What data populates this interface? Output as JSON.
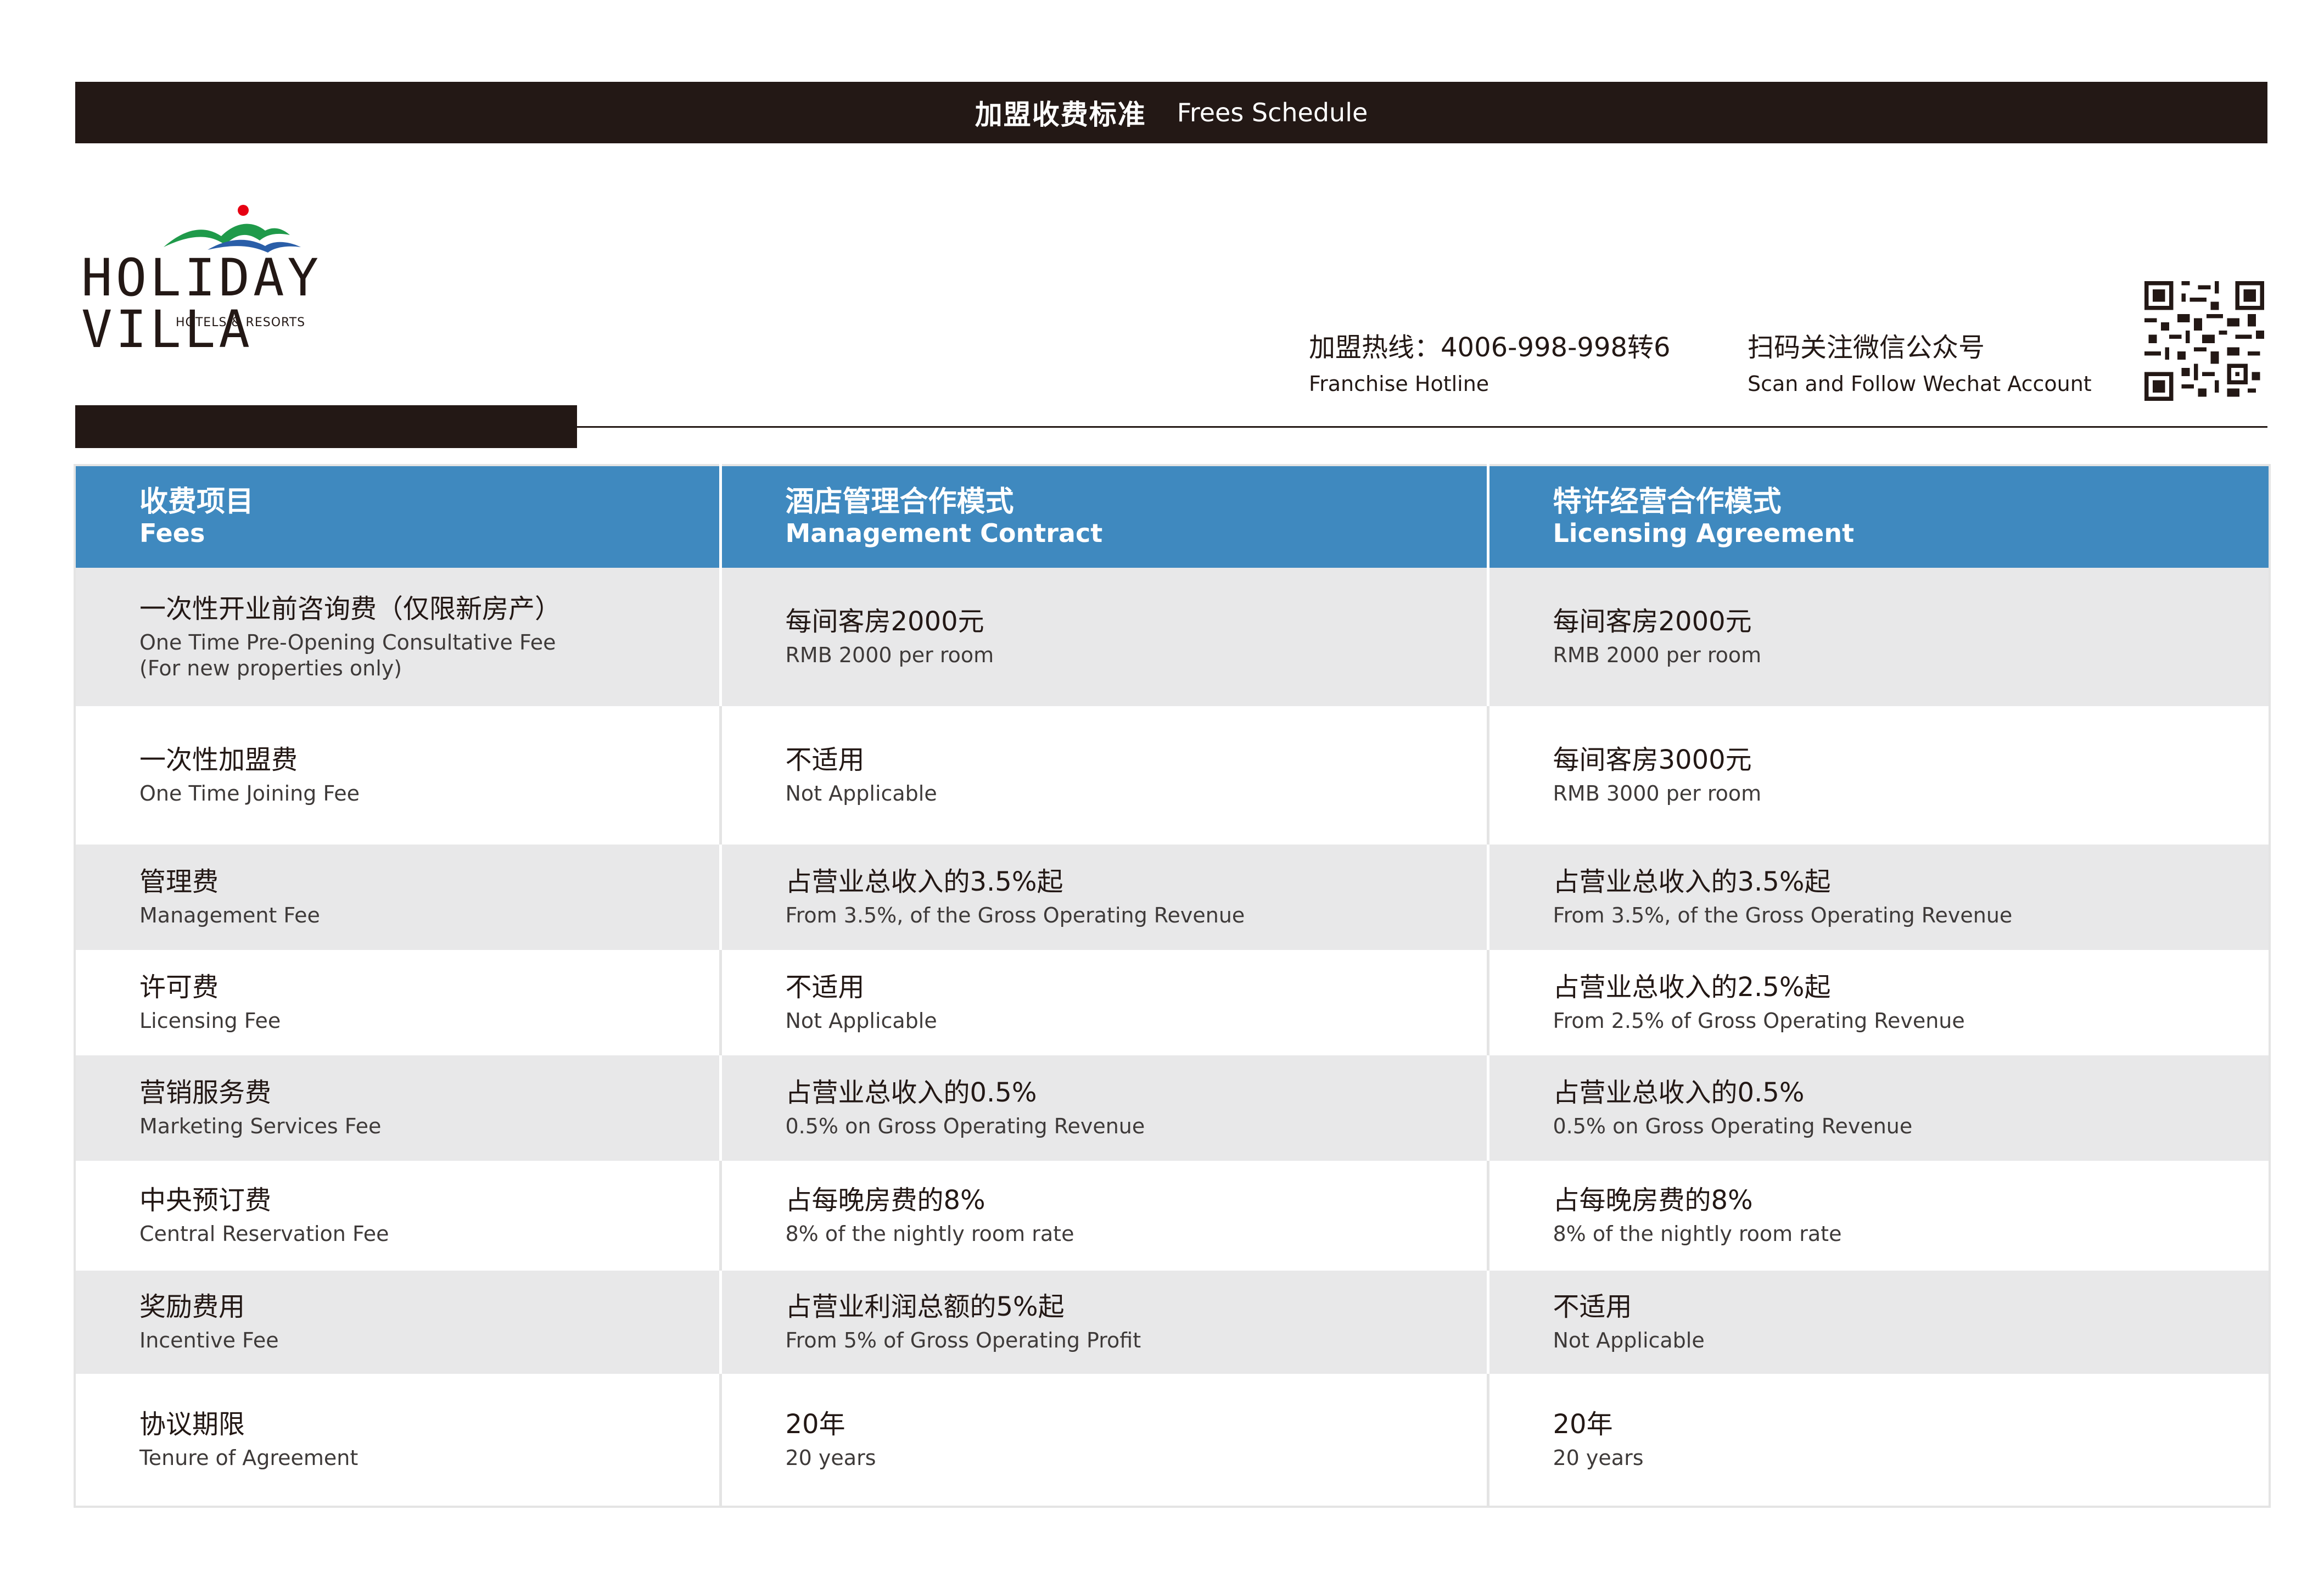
{
  "header": {
    "title_zh": "加盟收费标准",
    "title_en": "Frees Schedule"
  },
  "logo": {
    "wordmark": "HOLIDAY VILLA",
    "tagline": "HOTELS & RESORTS"
  },
  "contact": {
    "hotline_zh": "加盟热线：4006-998-998转6",
    "hotline_en": "Franchise Hotline",
    "wechat_zh": "扫码关注微信公众号",
    "wechat_en": "Scan and Follow Wechat Account"
  },
  "colors": {
    "header_blue": "#3f89bf",
    "dark": "#231815",
    "row_shade": "#e8e8e9",
    "logo_green": "#1f9a4a",
    "logo_blue": "#2a5ea8",
    "logo_red": "#e60012"
  },
  "table": {
    "headers": [
      {
        "zh": "收费项目",
        "en": "Fees"
      },
      {
        "zh": "酒店管理合作模式",
        "en": "Management Contract"
      },
      {
        "zh": "特许经营合作模式",
        "en": "Licensing Agreement"
      }
    ],
    "rows": [
      {
        "cells": [
          {
            "zh": "一次性开业前咨询费（仅限新房产）",
            "en": "One Time Pre-Opening Consultative Fee\n(For new properties only)"
          },
          {
            "zh": "每间客房2000元",
            "en": "RMB 2000 per room"
          },
          {
            "zh": "每间客房2000元",
            "en": "RMB 2000 per room"
          }
        ]
      },
      {
        "cells": [
          {
            "zh": "一次性加盟费",
            "en": "One Time Joining Fee"
          },
          {
            "zh": "不适用",
            "en": "Not Applicable"
          },
          {
            "zh": "每间客房3000元",
            "en": "RMB 3000 per room"
          }
        ]
      },
      {
        "cells": [
          {
            "zh": "管理费",
            "en": "Management Fee"
          },
          {
            "zh": "占营业总收入的3.5%起",
            "en": "From 3.5%, of the Gross Operating Revenue"
          },
          {
            "zh": "占营业总收入的3.5%起",
            "en": "From 3.5%, of the Gross Operating Revenue"
          }
        ]
      },
      {
        "cells": [
          {
            "zh": "许可费",
            "en": "Licensing Fee"
          },
          {
            "zh": "不适用",
            "en": "Not Applicable"
          },
          {
            "zh": "占营业总收入的2.5%起",
            "en": "From 2.5% of Gross Operating Revenue"
          }
        ]
      },
      {
        "cells": [
          {
            "zh": "营销服务费",
            "en": "Marketing Services Fee"
          },
          {
            "zh": "占营业总收入的0.5%",
            "en": "0.5% on Gross Operating Revenue"
          },
          {
            "zh": "占营业总收入的0.5%",
            "en": "0.5% on Gross Operating Revenue"
          }
        ]
      },
      {
        "cells": [
          {
            "zh": "中央预订费",
            "en": "Central Reservation Fee"
          },
          {
            "zh": "占每晚房费的8%",
            "en": "8% of the nightly room rate"
          },
          {
            "zh": "占每晚房费的8%",
            "en": "8% of the nightly room rate"
          }
        ]
      },
      {
        "cells": [
          {
            "zh": "奖励费用",
            "en": "Incentive Fee"
          },
          {
            "zh": "占营业利润总额的5%起",
            "en": "From 5% of Gross Operating Profit"
          },
          {
            "zh": "不适用",
            "en": "Not Applicable"
          }
        ]
      },
      {
        "cells": [
          {
            "zh": "协议期限",
            "en": "Tenure of Agreement"
          },
          {
            "zh": "20年",
            "en": "20 years"
          },
          {
            "zh": "20年",
            "en": "20 years"
          }
        ]
      }
    ]
  }
}
